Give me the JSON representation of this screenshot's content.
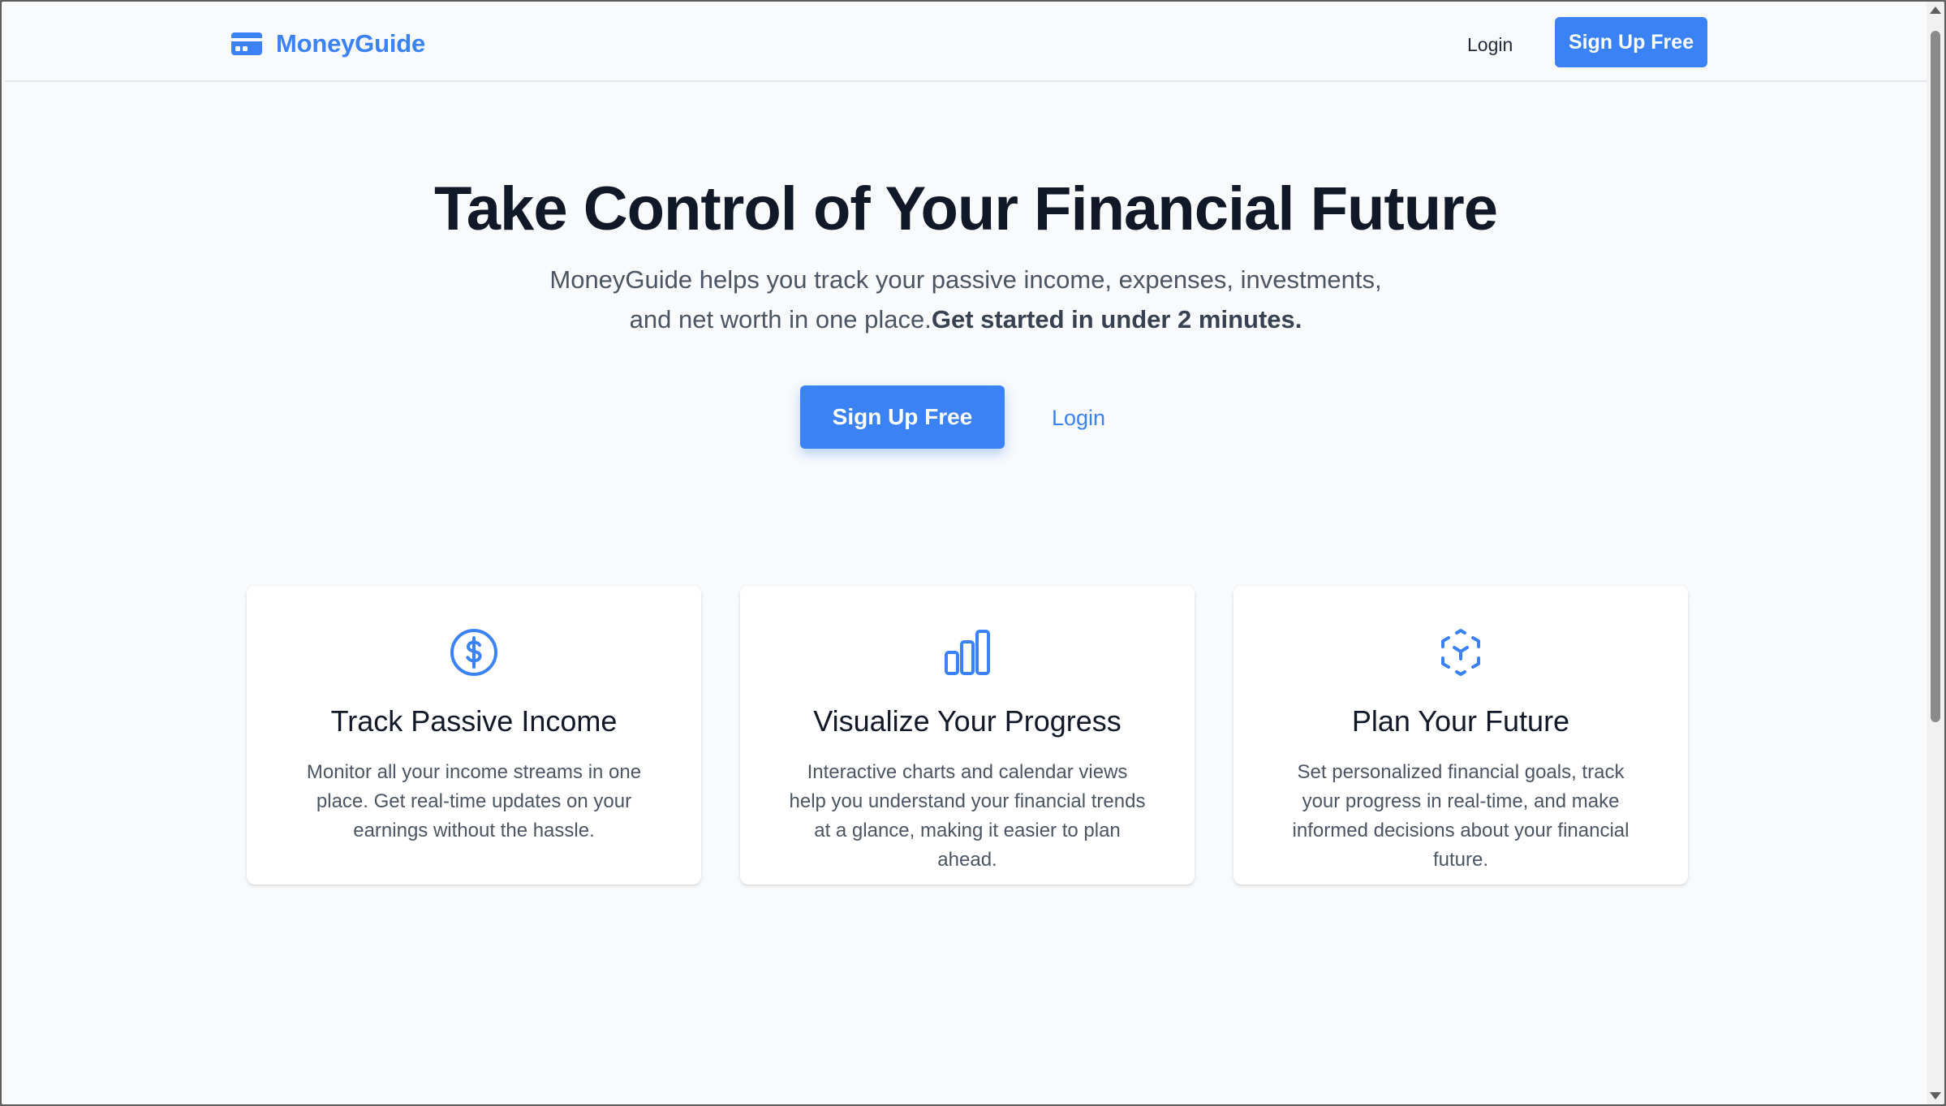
{
  "nav": {
    "brand_name": "MoneyGuide",
    "brand_icon": "wallet-icon",
    "login_label": "Login",
    "signup_label": "Sign Up Free"
  },
  "hero": {
    "title": "Take Control of Your Financial Future",
    "subtitle_line1": "MoneyGuide helps you track your passive income, expenses, investments,",
    "subtitle_line2": "and net worth in one place.",
    "subtitle_emphasis": "Get started in under 2 minutes.",
    "signup_label": "Sign Up Free",
    "login_label": "Login"
  },
  "features": [
    {
      "icon": "dollar-circle-icon",
      "title": "Track Passive Income",
      "description": "Monitor all your income streams in one place. Get real-time updates on your earnings without the hassle."
    },
    {
      "icon": "bar-chart-icon",
      "title": "Visualize Your Progress",
      "description": "Interactive charts and calendar views help you understand your financial trends at a glance, making it easier to plan ahead."
    },
    {
      "icon": "cube-focus-icon",
      "title": "Plan Your Future",
      "description": "Set personalized financial goals, track your progress in real-time, and make informed decisions about your financial future."
    }
  ],
  "colors": {
    "accent": "#3b82f6",
    "background": "#f8fafc",
    "heading": "#111827",
    "body_text": "#4b5563"
  }
}
